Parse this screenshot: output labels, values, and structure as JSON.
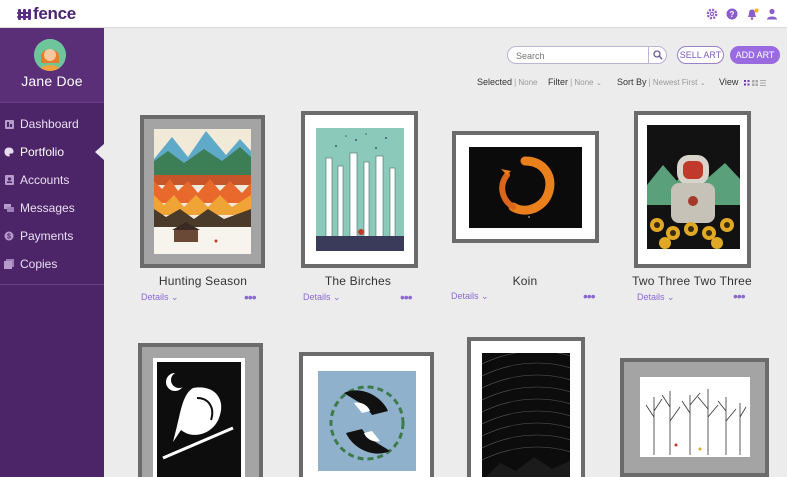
{
  "app": {
    "logo_text": "fence"
  },
  "topbar": {
    "icons": [
      "gear-icon",
      "help-icon",
      "bell-icon",
      "user-icon"
    ],
    "notification_dot_color": "#f2b500"
  },
  "colors": {
    "sidebar": "#4c2468",
    "accent": "#9a6ae0",
    "logo": "#4a2470"
  },
  "user": {
    "name": "Jane Doe"
  },
  "sidebar": {
    "items": [
      {
        "label": "Dashboard",
        "icon": "dashboard-icon",
        "active": false
      },
      {
        "label": "Portfolio",
        "icon": "palette-icon",
        "active": true
      },
      {
        "label": "Accounts",
        "icon": "accounts-icon",
        "active": false
      },
      {
        "label": "Messages",
        "icon": "messages-icon",
        "active": false
      },
      {
        "label": "Payments",
        "icon": "payments-icon",
        "active": false
      },
      {
        "label": "Copies",
        "icon": "copies-icon",
        "active": false
      }
    ]
  },
  "toolbar": {
    "search_placeholder": "Search",
    "sell_label": "SELL ART",
    "add_label": "ADD ART"
  },
  "filters": {
    "selected_label": "Selected",
    "selected_value": "None",
    "filter_label": "Filter",
    "filter_value": "None",
    "sort_label": "Sort By",
    "sort_value": "Newest First",
    "view_label": "View"
  },
  "artworks": [
    {
      "title": "Hunting Season",
      "details_label": "Details",
      "more": "•••"
    },
    {
      "title": "The Birches",
      "details_label": "Details",
      "more": "•••"
    },
    {
      "title": "Koin",
      "details_label": "Details",
      "more": "•••"
    },
    {
      "title": "Two Three Two Three",
      "details_label": "Details",
      "more": "•••"
    }
  ]
}
